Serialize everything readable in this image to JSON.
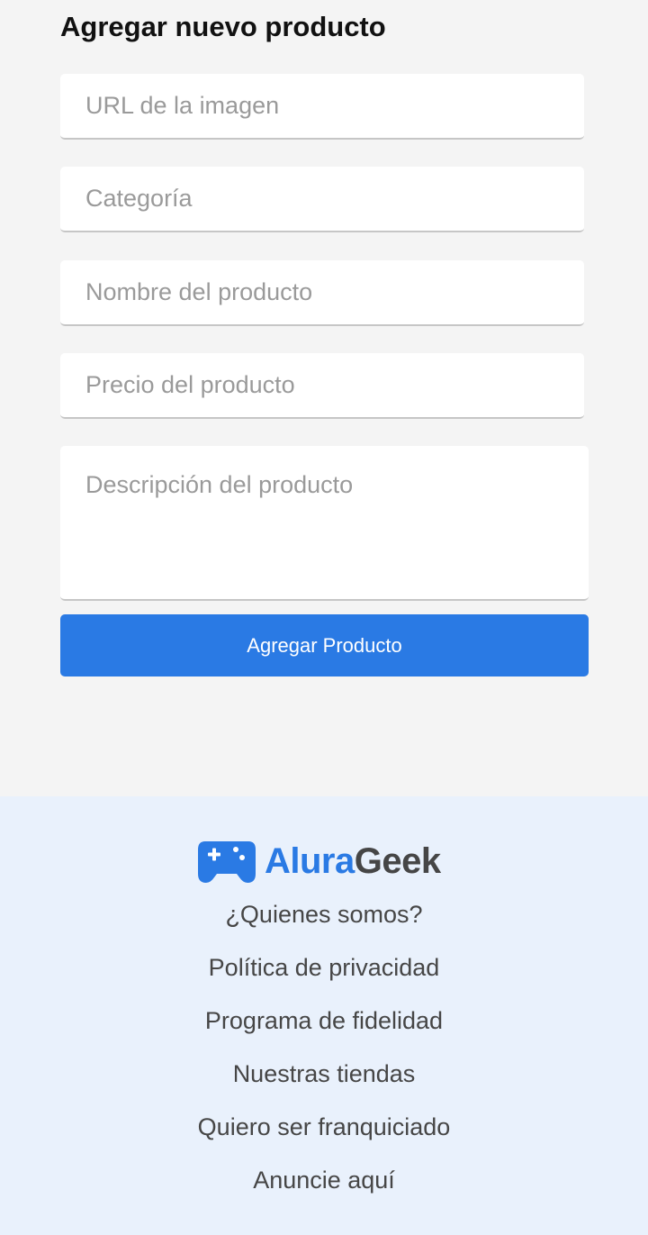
{
  "form": {
    "title": "Agregar nuevo producto",
    "fields": {
      "image_url": {
        "placeholder": "URL de la imagen",
        "value": ""
      },
      "category": {
        "placeholder": "Categoría",
        "value": ""
      },
      "name": {
        "placeholder": "Nombre del producto",
        "value": ""
      },
      "price": {
        "placeholder": "Precio del producto",
        "value": ""
      },
      "description": {
        "placeholder": "Descripción del producto",
        "value": ""
      }
    },
    "submit_label": "Agregar Producto"
  },
  "footer": {
    "logo": {
      "part1": "Alura",
      "part2": "Geek",
      "icon": "gamepad-icon"
    },
    "links": [
      "¿Quienes somos?",
      "Política de privacidad",
      "Programa de fidelidad",
      "Nuestras tiendas",
      "Quiero ser franquiciado",
      "Anuncie aquí"
    ]
  },
  "colors": {
    "accent": "#2a7ae4",
    "background": "#f4f4f4",
    "footer_background": "#e9f1fc",
    "text_dark": "#464646"
  }
}
